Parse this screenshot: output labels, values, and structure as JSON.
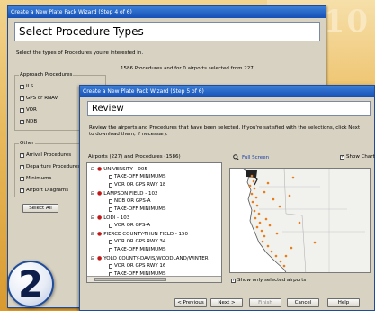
{
  "wizard_back": {
    "title": "Create a New Plate Pack Wizard  (Step 4 of 6)",
    "heading": "Select Procedure Types",
    "description": "Select the types of Procedures you're interested in.",
    "summary": "1586 Procedures and for 0 airports selected from 227",
    "group_approach": {
      "label": "Approach Procedures",
      "items": [
        {
          "label": "ILS",
          "checked": true
        },
        {
          "label": "GPS or RNAV",
          "checked": true
        },
        {
          "label": "VOR",
          "checked": true
        },
        {
          "label": "NDB",
          "checked": true
        }
      ]
    },
    "group_other": {
      "label": "Other",
      "items": [
        {
          "label": "Arrival Procedures",
          "checked": true
        },
        {
          "label": "Departure Procedures",
          "checked": true
        },
        {
          "label": "Minimums",
          "checked": true
        },
        {
          "label": "Airport Diagrams",
          "checked": true
        }
      ]
    },
    "select_all_label": "Select All"
  },
  "wizard_front": {
    "title": "Create a New Plate Pack Wizard  (Step 5 of 6)",
    "heading": "Review",
    "description": "Review the airports and Procedures that have been selected.  If you're satisfied with the selections, click Next to download them, if necessary.",
    "tree_label": "Airports (227) and Procedures (1586)",
    "full_screen_label": "Full Screen",
    "show_chart_label": "Show Chart",
    "show_chart_checked": true,
    "show_only_selected_label": "Show only selected airports",
    "show_only_selected_checked": true,
    "tree": [
      {
        "type": "airport",
        "label": "UNIVERSITY - 005"
      },
      {
        "type": "procedure",
        "label": "TAKE-OFF MINIMUMS"
      },
      {
        "type": "procedure",
        "label": "VOR OR GPS RWY 18"
      },
      {
        "type": "airport",
        "label": "LAMPSON FIELD - 102"
      },
      {
        "type": "procedure",
        "label": "NDB OR GPS-A"
      },
      {
        "type": "procedure",
        "label": "TAKE-OFF MINIMUMS"
      },
      {
        "type": "airport",
        "label": "LODI - 103"
      },
      {
        "type": "procedure",
        "label": "VOR OR GPS-A"
      },
      {
        "type": "airport",
        "label": "PIERCE COUNTY-THUN FIELD - 150"
      },
      {
        "type": "procedure",
        "label": "VOR OR GPS RWY 34"
      },
      {
        "type": "procedure",
        "label": "TAKE-OFF MINIMUMS"
      },
      {
        "type": "airport",
        "label": "YOLO COUNTY-DAVIS/WOODLAND/WINTER"
      },
      {
        "type": "procedure",
        "label": "VOR OR GPS RWY 16"
      },
      {
        "type": "procedure",
        "label": "TAKE-OFF MINIMUMS"
      }
    ],
    "buttons": {
      "previous": "< Previous",
      "next": "Next >",
      "finish": "Finish",
      "cancel": "Cancel",
      "help": "Help"
    }
  },
  "step_badge": "2",
  "background_text": "10",
  "colors": {
    "titlebar": "#1550b5",
    "background": "#e8b85a",
    "dialog": "#d8d2c2",
    "airport_pin": "#c01818",
    "map_dot": "#e87d1a"
  }
}
